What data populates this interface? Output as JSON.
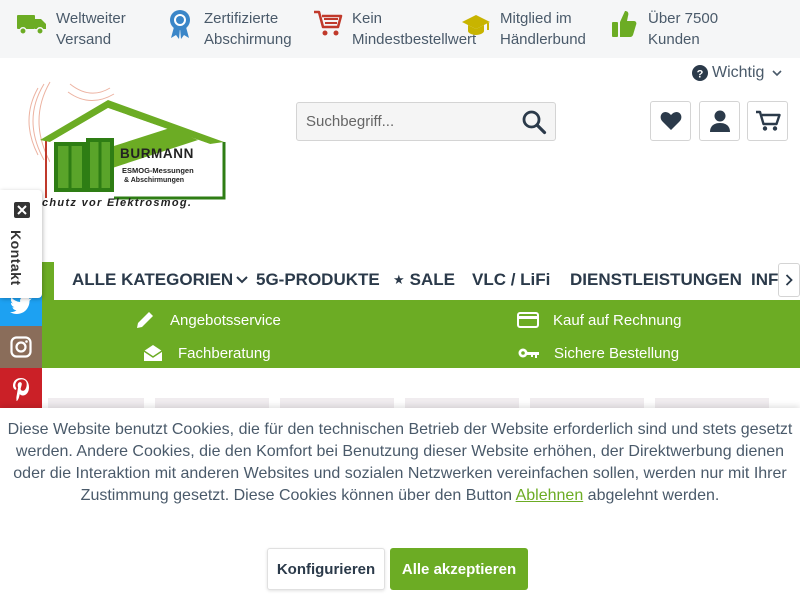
{
  "usp": [
    {
      "icon": "truck-icon",
      "line1": "Weltweiter",
      "line2": "Versand"
    },
    {
      "icon": "award-icon",
      "line1": "Zertifizierte",
      "line2": "Abschirmung"
    },
    {
      "icon": "cart-icon",
      "line1": "Kein",
      "line2": "Mindestbestellwert"
    },
    {
      "icon": "graduation-cap-icon",
      "line1": "Mitglied im",
      "line2": "Händlerbund"
    },
    {
      "icon": "thumbs-up-icon",
      "line1": "Über 7500",
      "line2": "Kunden"
    }
  ],
  "logo": {
    "brand": "BURMANN",
    "sub1": "ESMOG-Messungen",
    "sub2": "& Abschirmungen",
    "slogan": "chutz vor Elektrosmog."
  },
  "search": {
    "placeholder": "Suchbegriff..."
  },
  "header": {
    "wichtig": "Wichtig"
  },
  "nav": {
    "items": [
      "ALLE KATEGORIEN",
      "5G-PRODUKTE",
      "SALE",
      "VLC / LiFi",
      "DIENSTLEISTUNGEN",
      "INF"
    ]
  },
  "services": {
    "angebot": "Angebotsservice",
    "rechnung": "Kauf auf Rechnung",
    "beratung": "Fachberatung",
    "sicher": "Sichere Bestellung"
  },
  "sidebar": {
    "kontakt": "Kontakt"
  },
  "cookie": {
    "text_before": "Diese Website benutzt Cookies, die für den technischen Betrieb der Website erforderlich sind und stets gesetzt werden. Andere Cookies, die den Komfort bei Benutzung dieser Website erhöhen, der Direktwerbung dienen oder die Interaktion mit anderen Websites und sozialen Netzwerken vereinfachen sollen, werden nur mit Ihrer Zustimmung gesetzt. Diese Cookies können über den Button ",
    "link": "Ablehnen",
    "text_after": " abgelehnt werden.",
    "configure": "Konfigurieren",
    "accept_all": "Alle akzeptieren"
  },
  "colors": {
    "accent": "#6cac24",
    "text": "#4a5a6a",
    "twitter": "#1da1f2",
    "instagram": "#8a6d5a",
    "pinterest": "#cb2027"
  }
}
